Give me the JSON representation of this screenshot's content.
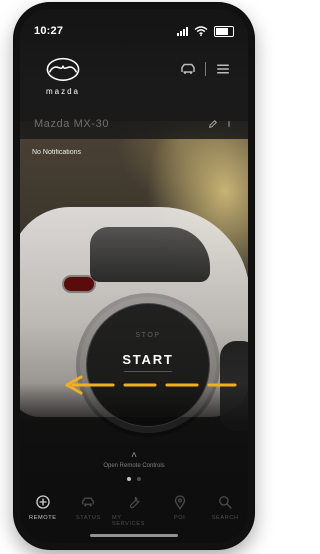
{
  "status": {
    "time": "10:27"
  },
  "brand": {
    "wordmark": "mazda"
  },
  "vehicle": {
    "name": "Mazda MX-30"
  },
  "notifications": {
    "text": "No Notifications"
  },
  "remote": {
    "stop_label": "STOP",
    "start_label": "START",
    "open_remote_controls": "Open Remote Controls",
    "swipe_arrow_color": "#F2B01E"
  },
  "bottom_tabs": [
    {
      "label": "REMOTE",
      "icon": "remote-icon",
      "active": true
    },
    {
      "label": "STATUS",
      "icon": "car-status-icon",
      "active": false
    },
    {
      "label": "MY SERVICES",
      "icon": "wrench-icon",
      "active": false
    },
    {
      "label": "POI",
      "icon": "map-pin-icon",
      "active": false
    },
    {
      "label": "SEARCH",
      "icon": "search-icon",
      "active": false
    }
  ],
  "carousel": {
    "active_page": 1,
    "pages": 2
  }
}
